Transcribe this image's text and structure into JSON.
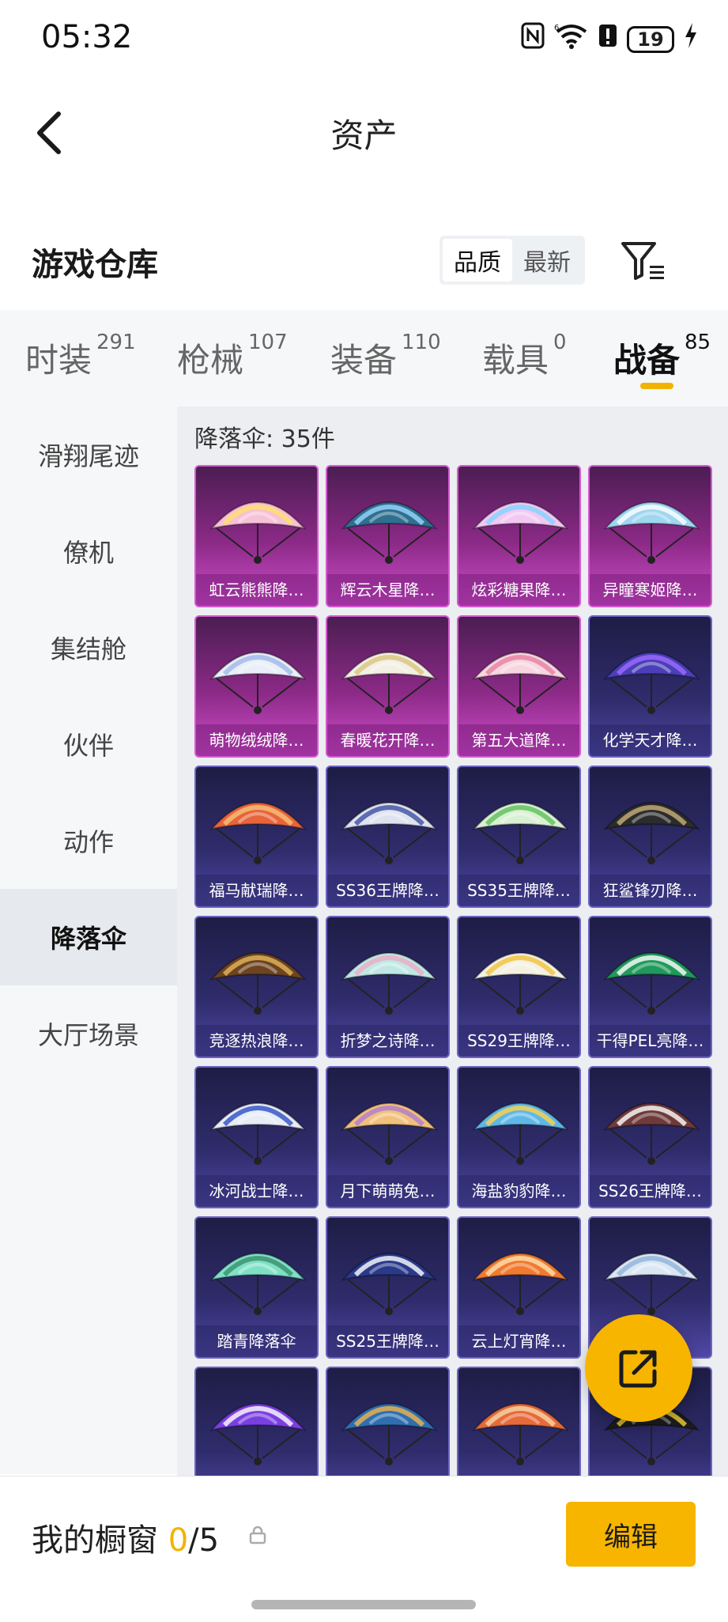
{
  "status": {
    "time": "05:32",
    "battery": "19"
  },
  "header": {
    "title": "资产"
  },
  "warehouse": {
    "title": "游戏仓库",
    "sort": [
      "品质",
      "最新"
    ]
  },
  "tabs": [
    {
      "label": "时装",
      "count": "291"
    },
    {
      "label": "枪械",
      "count": "107"
    },
    {
      "label": "装备",
      "count": "110"
    },
    {
      "label": "载具",
      "count": "0"
    },
    {
      "label": "战备",
      "count": "85",
      "active": true
    }
  ],
  "sidebar": [
    "滑翔尾迹",
    "僚机",
    "集结舱",
    "伙伴",
    "动作",
    "降落伞",
    "大厅场景"
  ],
  "content": {
    "count_label": "降落伞: 35件",
    "items": [
      {
        "name": "虹云熊熊降…",
        "rarity": "purple",
        "color": "#f7c1d6",
        "accent": "#ffe066"
      },
      {
        "name": "辉云木星降…",
        "rarity": "purple",
        "color": "#2f6f8f",
        "accent": "#9ad8ff"
      },
      {
        "name": "炫彩糖果降…",
        "rarity": "purple",
        "color": "#f2c8f2",
        "accent": "#7fd4ff"
      },
      {
        "name": "异瞳寒姬降…",
        "rarity": "purple",
        "color": "#9fd6f0",
        "accent": "#ffffff"
      },
      {
        "name": "萌物绒绒降…",
        "rarity": "purple",
        "color": "#e9eef8",
        "accent": "#9fb6e6"
      },
      {
        "name": "春暖花开降…",
        "rarity": "purple",
        "color": "#f2efe4",
        "accent": "#d9c37a"
      },
      {
        "name": "第五大道降…",
        "rarity": "purple",
        "color": "#f7d6e0",
        "accent": "#e67fa3"
      },
      {
        "name": "化学天才降…",
        "rarity": "blue",
        "color": "#4a3fb8",
        "accent": "#9f6bff"
      },
      {
        "name": "福马献瑞降…",
        "rarity": "blue",
        "color": "#e8643a",
        "accent": "#f4c27a"
      },
      {
        "name": "SS36王牌降…",
        "rarity": "blue",
        "color": "#dfe3ef",
        "accent": "#3d4ea3"
      },
      {
        "name": "SS35王牌降…",
        "rarity": "blue",
        "color": "#d9f0d2",
        "accent": "#5bbf5a"
      },
      {
        "name": "狂鲨锋刃降…",
        "rarity": "blue",
        "color": "#2c2c2c",
        "accent": "#c9b27a"
      },
      {
        "name": "竞逐热浪降…",
        "rarity": "blue",
        "color": "#6e4420",
        "accent": "#e3b85a"
      },
      {
        "name": "折梦之诗降…",
        "rarity": "blue",
        "color": "#bfe8e4",
        "accent": "#f0a9c3"
      },
      {
        "name": "SS29王牌降…",
        "rarity": "blue",
        "color": "#f3f1e2",
        "accent": "#f2c23a"
      },
      {
        "name": "干得PEL亮降…",
        "rarity": "blue",
        "color": "#1f9a5a",
        "accent": "#ffffff"
      },
      {
        "name": "冰河战士降…",
        "rarity": "blue",
        "color": "#e8ecf7",
        "accent": "#2d4fc4"
      },
      {
        "name": "月下萌萌兔…",
        "rarity": "blue",
        "color": "#f1c07a",
        "accent": "#b07ad6"
      },
      {
        "name": "海盐豹豹降…",
        "rarity": "blue",
        "color": "#5fb7e6",
        "accent": "#ffd24a"
      },
      {
        "name": "SS26王牌降…",
        "rarity": "blue",
        "color": "#6e3a3a",
        "accent": "#ffffff"
      },
      {
        "name": "踏青降落伞",
        "rarity": "blue",
        "color": "#7fe0c6",
        "accent": "#3a8f6a"
      },
      {
        "name": "SS25王牌降…",
        "rarity": "blue",
        "color": "#2a3a8a",
        "accent": "#ffffff"
      },
      {
        "name": "云上灯宵降…",
        "rarity": "blue",
        "color": "#f07a2e",
        "accent": "#ffe2b0"
      },
      {
        "name": "",
        "rarity": "blue",
        "color": "#dbe6f3",
        "accent": "#8fb3d9"
      },
      {
        "name": "",
        "rarity": "blue",
        "color": "#7a3fe0",
        "accent": "#ffffff"
      },
      {
        "name": "",
        "rarity": "blue",
        "color": "#2f6fb0",
        "accent": "#f3b44a"
      },
      {
        "name": "",
        "rarity": "blue",
        "color": "#e66a3a",
        "accent": "#f7d7a8"
      },
      {
        "name": "",
        "rarity": "blue",
        "color": "#1c1c1c",
        "accent": "#f2d23a"
      }
    ]
  },
  "bottom": {
    "label": "我的橱窗",
    "current": "0",
    "total": "/5",
    "edit": "编辑"
  },
  "colors": {
    "accent": "#f7b500"
  }
}
